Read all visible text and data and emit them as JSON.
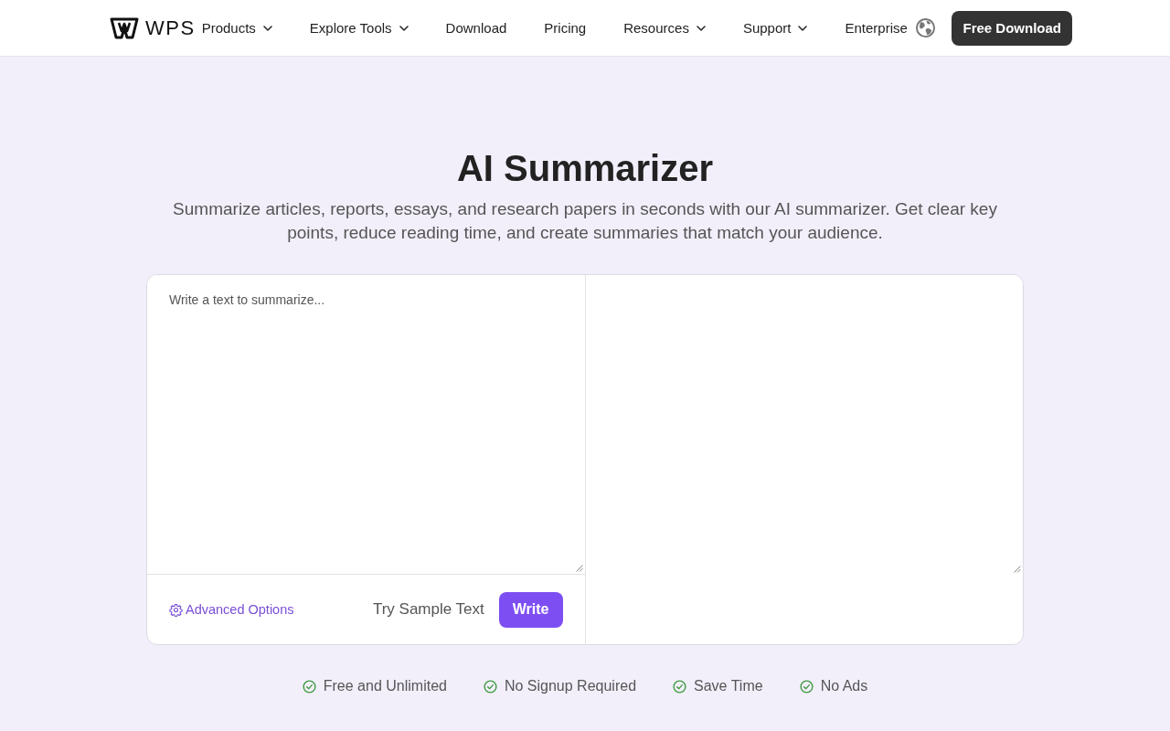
{
  "nav": {
    "logo": "WPS",
    "items": [
      {
        "label": "Products",
        "dropdown": true
      },
      {
        "label": "Explore Tools",
        "dropdown": true
      },
      {
        "label": "Download",
        "dropdown": false
      },
      {
        "label": "Pricing",
        "dropdown": false
      },
      {
        "label": "Resources",
        "dropdown": true
      },
      {
        "label": "Support",
        "dropdown": true
      },
      {
        "label": "Enterprise",
        "dropdown": false
      }
    ],
    "cta": "Free Download"
  },
  "hero": {
    "title": "AI Summarizer",
    "subtitle": "Summarize articles, reports, essays, and research papers in seconds with our AI summarizer. Get clear key points, reduce reading time, and create summaries that match your audience."
  },
  "editor": {
    "input": {
      "placeholder": "Write a text to summarize..."
    },
    "advanced_options": "Advanced Options",
    "sample_button": "Try Sample Text",
    "write_button": "Write"
  },
  "features": [
    {
      "label": "Free and Unlimited"
    },
    {
      "label": "No Signup Required"
    },
    {
      "label": "Save Time"
    },
    {
      "label": "No Ads"
    }
  ]
}
